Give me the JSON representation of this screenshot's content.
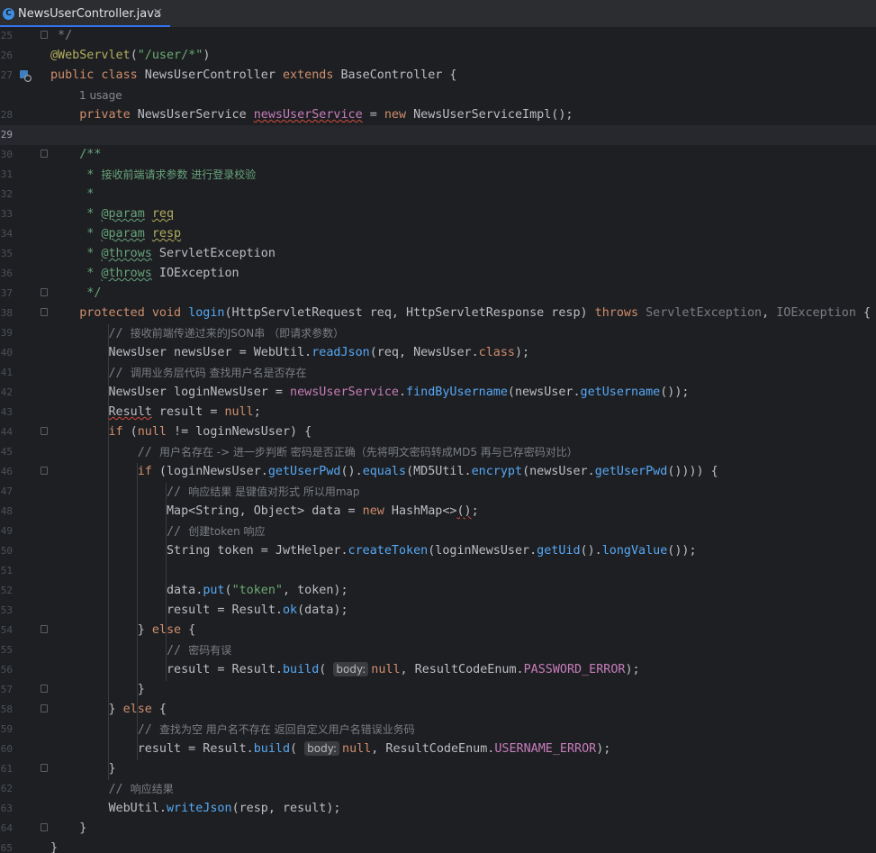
{
  "tab": {
    "icon": "C",
    "filename": "NewsUserController.java",
    "close": "×"
  },
  "lines": [
    {
      "n": "25",
      "t": " */"
    },
    {
      "n": "26",
      "t": "@WebServlet(\"/user/*\")"
    },
    {
      "n": "27",
      "t": "public class NewsUserController extends BaseController {"
    },
    {
      "n": "",
      "t": "1 usage"
    },
    {
      "n": "28",
      "t": "    private NewsUserService newsUserService = new NewsUserServiceImpl();"
    },
    {
      "n": "29",
      "t": ""
    },
    {
      "n": "30",
      "t": "    /**"
    },
    {
      "n": "31",
      "t": "     * 接收前端请求参数 进行登录校验"
    },
    {
      "n": "32",
      "t": "     *"
    },
    {
      "n": "33",
      "t": "     * @param req"
    },
    {
      "n": "34",
      "t": "     * @param resp"
    },
    {
      "n": "35",
      "t": "     * @throws ServletException"
    },
    {
      "n": "36",
      "t": "     * @throws IOException"
    },
    {
      "n": "37",
      "t": "     */"
    },
    {
      "n": "38",
      "t": "    protected void login(HttpServletRequest req, HttpServletResponse resp) throws ServletException, IOException {"
    },
    {
      "n": "39",
      "t": "        // 接收前端传递过来的JSON串 （即请求参数）"
    },
    {
      "n": "40",
      "t": "        NewsUser newsUser = WebUtil.readJson(req, NewsUser.class);"
    },
    {
      "n": "41",
      "t": "        // 调用业务层代码 查找用户名是否存在"
    },
    {
      "n": "42",
      "t": "        NewsUser loginNewsUser = newsUserService.findByUsername(newsUser.getUsername());"
    },
    {
      "n": "43",
      "t": "        Result result = null;"
    },
    {
      "n": "44",
      "t": "        if (null != loginNewsUser) {"
    },
    {
      "n": "45",
      "t": "            // 用户名存在 -> 进一步判断 密码是否正确（先将明文密码转成MD5 再与已存密码对比）"
    },
    {
      "n": "46",
      "t": "            if (loginNewsUser.getUserPwd().equals(MD5Util.encrypt(newsUser.getUserPwd()))) {"
    },
    {
      "n": "47",
      "t": "                // 响应结果 是键值对形式 所以用map"
    },
    {
      "n": "48",
      "t": "                Map<String, Object> data = new HashMap<>();"
    },
    {
      "n": "49",
      "t": "                // 创建token 响应"
    },
    {
      "n": "50",
      "t": "                String token = JwtHelper.createToken(loginNewsUser.getUid().longValue());"
    },
    {
      "n": "51",
      "t": ""
    },
    {
      "n": "52",
      "t": "                data.put(\"token\", token);"
    },
    {
      "n": "53",
      "t": "                result = Result.ok(data);"
    },
    {
      "n": "54",
      "t": "            } else {"
    },
    {
      "n": "55",
      "t": "                // 密码有误"
    },
    {
      "n": "56",
      "t": "                result = Result.build( body: null, ResultCodeEnum.PASSWORD_ERROR);"
    },
    {
      "n": "57",
      "t": "            }"
    },
    {
      "n": "58",
      "t": "        } else {"
    },
    {
      "n": "59",
      "t": "            // 查找为空 用户名不存在 返回自定义用户名错误业务码"
    },
    {
      "n": "60",
      "t": "            result = Result.build( body: null, ResultCodeEnum.USERNAME_ERROR);"
    },
    {
      "n": "61",
      "t": "        }"
    },
    {
      "n": "62",
      "t": "        // 响应结果"
    },
    {
      "n": "63",
      "t": "        WebUtil.writeJson(resp, result);"
    },
    {
      "n": "64",
      "t": "    }"
    },
    {
      "n": "65",
      "t": "}"
    }
  ],
  "icons": {
    "tab_file": "java-class-icon",
    "gutter_27": "servlet-run-icon",
    "fold": "fold-marker-icon"
  },
  "colors": {
    "background": "#1e1f22",
    "keyword": "#cf8e6d",
    "string": "#6aab73",
    "method": "#56a8f5",
    "field": "#c77dbb",
    "comment": "#7a7e85",
    "annotation": "#b3ae60"
  }
}
